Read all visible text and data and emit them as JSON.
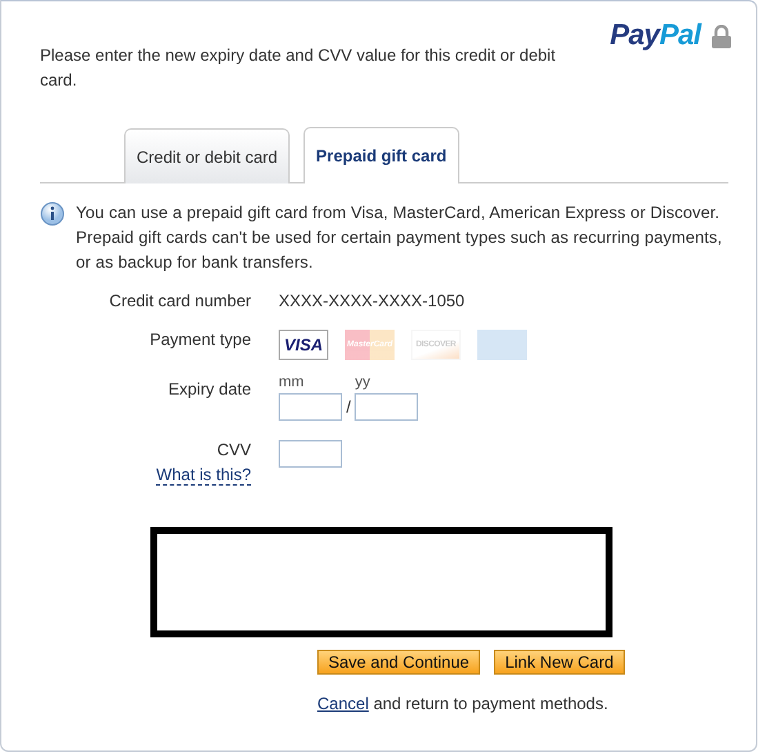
{
  "logo": {
    "text_dark": "Pay",
    "text_light": "Pal"
  },
  "intro": "Please enter the new expiry date and CVV value for this credit or debit card.",
  "tabs": [
    {
      "label": "Credit or debit card",
      "selected": false
    },
    {
      "label": "Prepaid gift card",
      "selected": true
    }
  ],
  "info": "You can use a prepaid gift card from Visa, MasterCard, American Express or Discover. Prepaid gift cards can't be used for certain payment types such as recurring payments, or as backup for bank transfers.",
  "card_number": {
    "label": "Credit card number",
    "value": "XXXX-XXXX-XXXX-1050"
  },
  "payment_type": {
    "label": "Payment type",
    "options": [
      {
        "kind": "visa",
        "label": "VISA",
        "selected": true
      },
      {
        "kind": "mastercard",
        "label": "MasterCard",
        "selected": false
      },
      {
        "kind": "discover",
        "label": "DISCOVER",
        "selected": false
      },
      {
        "kind": "amex",
        "selected": false
      }
    ]
  },
  "expiry": {
    "label": "Expiry date",
    "month_label": "mm",
    "year_label": "yy",
    "separator": "/"
  },
  "cvv": {
    "label": "CVV",
    "help_link": "What is this?"
  },
  "buttons": [
    "Save and Continue",
    "Link New Card"
  ],
  "footer": {
    "link": "Cancel",
    "text": "and return to payment methods."
  }
}
